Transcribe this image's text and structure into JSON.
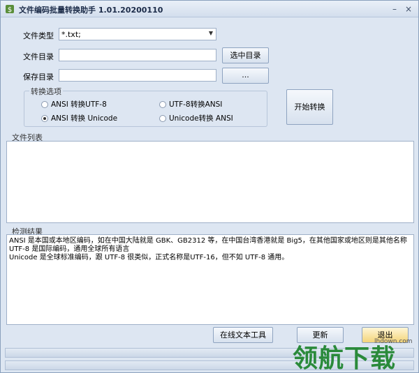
{
  "window": {
    "title": "文件编码批量转换助手 1.01.20200110",
    "minimize_glyph": "–",
    "close_glyph": "×"
  },
  "form": {
    "file_type_label": "文件类型",
    "file_type_value": "*.txt;",
    "file_dir_label": "文件目录",
    "file_dir_value": "",
    "select_dir_button": "选中目录",
    "save_dir_label": "保存目录",
    "save_dir_value": "",
    "browse_button": "..."
  },
  "options": {
    "group_title": "转换选项",
    "items": [
      {
        "label": "ANSI 转换UTF-8",
        "selected": false
      },
      {
        "label": "UTF-8转换ANSI",
        "selected": false
      },
      {
        "label": "ANSI 转换 Unicode",
        "selected": true
      },
      {
        "label": "Unicode转换 ANSI",
        "selected": false
      }
    ]
  },
  "start_button": "开始转换",
  "file_list": {
    "title": "文件列表"
  },
  "results": {
    "title": "检测结果",
    "text": "ANSI 是本国或本地区编码，如在中国大陆就是 GBK、GB2312 等，在中国台湾香港就是 Big5，在其他国家或地区则是其他名称\nUTF-8 是国际编码，通用全球所有语言\nUnicode 是全球标准编码，跟 UTF-8 很类似，正式名称是UTF-16，但不如 UTF-8 通用。"
  },
  "bottom_buttons": {
    "online_tool": "在线文本工具",
    "update": "更新",
    "exit": "退出"
  },
  "watermark": {
    "text": "领航下载",
    "url": "lhdown.com"
  }
}
